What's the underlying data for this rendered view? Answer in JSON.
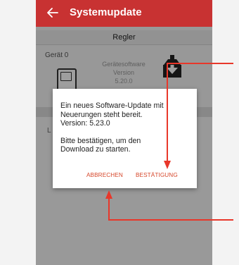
{
  "app_bar": {
    "title": "Systemupdate",
    "back_icon": "arrow-left-icon",
    "color": "#c83232"
  },
  "tab": {
    "label": "Regler"
  },
  "device": {
    "label": "Gerät 0",
    "firmware_label_1": "Gerätesoftware",
    "firmware_label_2": "Version",
    "firmware_version": "5.20.0",
    "install_icon": "download-box-icon"
  },
  "list": {
    "letter": "L"
  },
  "dialog": {
    "line1": "Ein neues Software-Update mit",
    "line2": "Neuerungen steht bereit.",
    "line3": "Version: 5.23.0",
    "line4": "Bitte bestätigen, um den",
    "line5": "Download zu starten.",
    "cancel_label": "ABBRECHEN",
    "confirm_label": "BESTÄTIGUNG",
    "accent_color": "#d6462a"
  },
  "annotation_color": "#e8372a"
}
